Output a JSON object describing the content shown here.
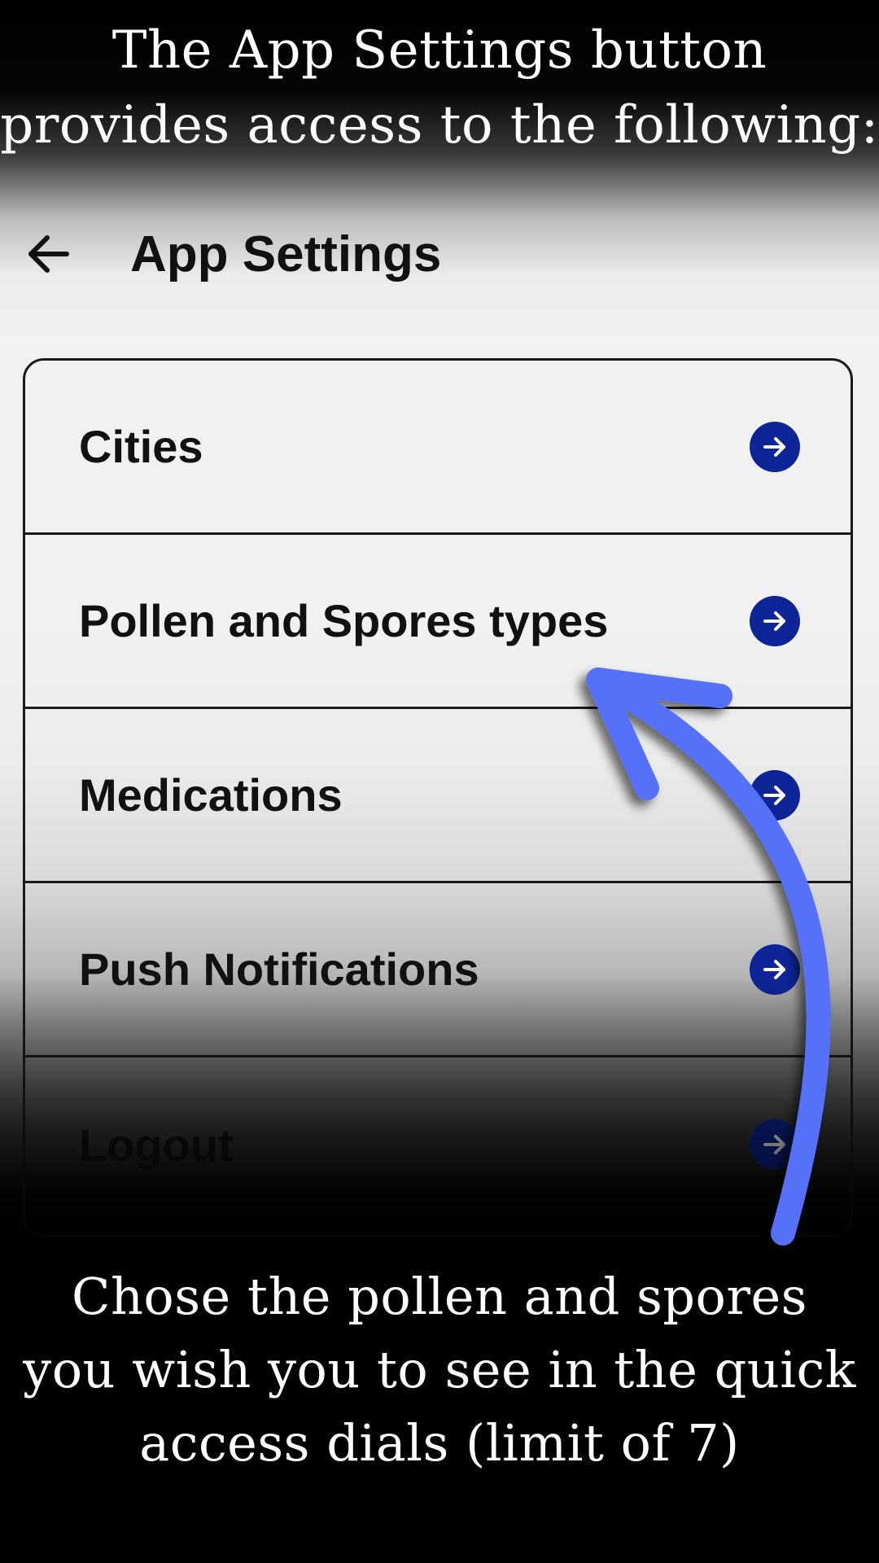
{
  "caption_top": {
    "line1": "The App Settings button",
    "line2": "provides access to the following:"
  },
  "header": {
    "back_icon": "arrow-left-icon",
    "title": "App Settings"
  },
  "menu": {
    "items": [
      {
        "label": "Cities",
        "icon": "arrow-right-circle-icon"
      },
      {
        "label": "Pollen and Spores types",
        "icon": "arrow-right-circle-icon"
      },
      {
        "label": "Medications",
        "icon": "arrow-right-circle-icon"
      },
      {
        "label": "Push Notifications",
        "icon": "arrow-right-circle-icon"
      },
      {
        "label": "Logout",
        "icon": "arrow-right-circle-icon"
      }
    ]
  },
  "caption_bottom": {
    "line1": "Chose the pollen and spores",
    "line2": "you wish you to see in the quick",
    "line3": "access dials (limit of 7)"
  },
  "colors": {
    "icon_background": "#0d2596",
    "annotation_arrow": "#5571fa",
    "caption_text": "#ffffff",
    "ui_text": "#111111"
  }
}
